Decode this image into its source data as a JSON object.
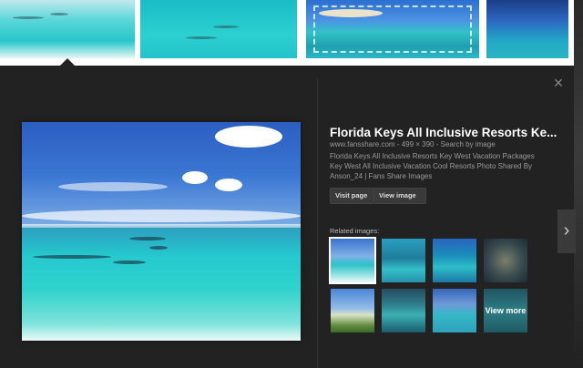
{
  "panel": {
    "close_icon": "×",
    "title": "Florida Keys All Inclusive Resorts Ke...",
    "meta": "www.fansshare.com - 499 × 390 - Search by image",
    "description": "Florida Keys All Inclusive Resorts Key West Vacation Packages Key West All Inclusive Vacation Cool Resorts Photo Shared By Anson_24 | Fans Share Images",
    "visit_page_label": "Visit page",
    "view_image_label": "View image",
    "related_label": "Related images:",
    "view_more_label": "View more",
    "next_icon": "›"
  },
  "icons": {
    "close": "close-icon",
    "next": "chevron-right-icon"
  }
}
